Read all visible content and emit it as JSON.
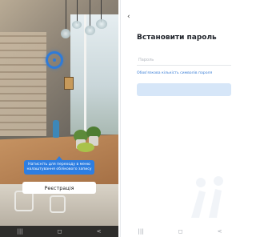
{
  "left_screen": {
    "status": {
      "time": "",
      "icons": ""
    },
    "tooltip_text": "Натисніть для переходу в меню налаштування облікового запису",
    "register_button_label": "Реєстрація",
    "nav": {
      "menu": "|||",
      "home": "◻",
      "back": "<"
    }
  },
  "right_screen": {
    "status": {
      "time": "",
      "icons": ""
    },
    "back_icon": "‹",
    "title": "Встановити пароль",
    "password_placeholder": "Пароль",
    "hint_link": "Обов'язкова кількість символів пароля",
    "confirm_button_label": "",
    "nav": {
      "menu": "|||",
      "home": "◻",
      "back": "<"
    }
  },
  "colors": {
    "accent": "#2d7ee2",
    "button_disabled": "#d6e6f8",
    "link": "#3c7fd6"
  }
}
